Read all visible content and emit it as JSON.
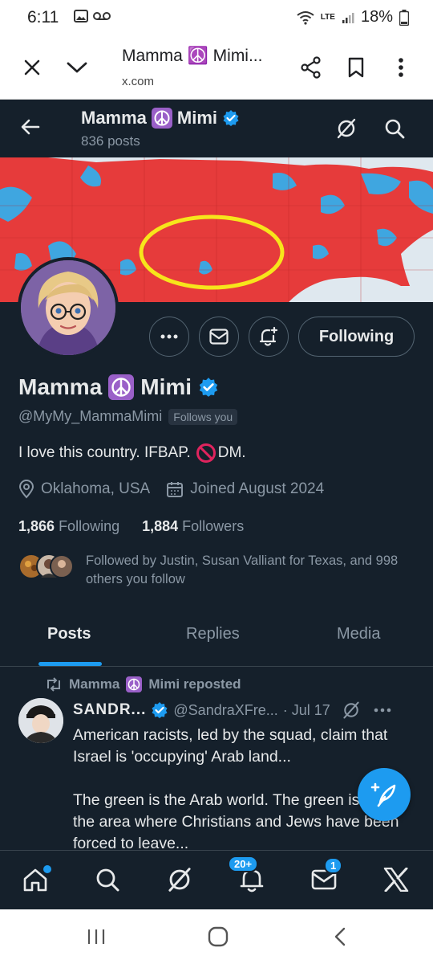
{
  "status_bar": {
    "time": "6:11",
    "network": "LTE",
    "battery": "18%"
  },
  "browser": {
    "title": "Mamma ☮️ Mimi...",
    "url": "x.com"
  },
  "header": {
    "name": "Mamma",
    "name_suffix": "Mimi",
    "posts_count": "836 posts"
  },
  "profile": {
    "name": "Mamma",
    "name_suffix": "Mimi",
    "handle": "@MyMy_MammaMimi",
    "follows_you": "Follows you",
    "bio_part1": "I love this country. IFBAP.",
    "bio_part2": "DM.",
    "location": "Oklahoma, USA",
    "joined": "Joined August 2024",
    "following_count": "1,866",
    "following_label": "Following",
    "followers_count": "1,884",
    "followers_label": "Followers",
    "followed_by": "Followed by Justin, Susan Valliant for Texas, and 998 others you follow",
    "follow_button": "Following"
  },
  "tabs": [
    {
      "label": "Posts",
      "active": true
    },
    {
      "label": "Replies",
      "active": false
    },
    {
      "label": "Media",
      "active": false
    }
  ],
  "post": {
    "repost_label": "Mamma",
    "repost_suffix": "Mimi reposted",
    "author_name": "SANDR...",
    "author_handle": "@SandraXFre...",
    "date": "· Jul 17",
    "text_line1": "American racists, led by the squad, claim that Israel is 'occupying' Arab land...",
    "text_line2": "The green is the Arab world. The green is also the area where Christians and Jews have been forced to leave..."
  },
  "bottom_nav": {
    "notifications_badge": "20+",
    "messages_badge": "1"
  },
  "colors": {
    "background": "#15202b",
    "accent": "#1d9bf0",
    "text": "#e7e9ea",
    "muted": "#8b98a5"
  }
}
